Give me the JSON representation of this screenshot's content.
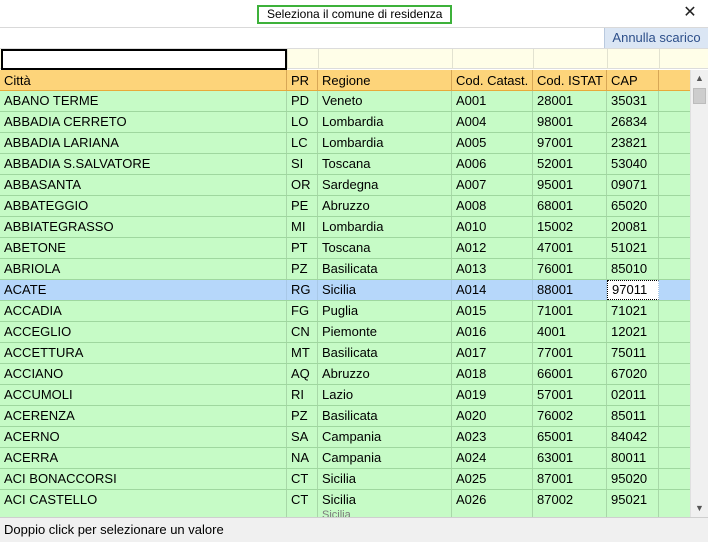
{
  "window": {
    "title": "Seleziona il comune di residenza",
    "close_glyph": "✕",
    "close_icon": "close-icon"
  },
  "toolbar": {
    "annulla_label": "Annulla scarico"
  },
  "filter": {
    "value": "",
    "placeholder": ""
  },
  "columns": [
    "Città",
    "PR",
    "Regione",
    "Cod. Catast.",
    "Cod. ISTAT",
    "CAP"
  ],
  "rows": [
    [
      "ABANO TERME",
      "PD",
      "Veneto",
      "A001",
      "28001",
      "35031"
    ],
    [
      "ABBADIA CERRETO",
      "LO",
      "Lombardia",
      "A004",
      "98001",
      "26834"
    ],
    [
      "ABBADIA LARIANA",
      "LC",
      "Lombardia",
      "A005",
      "97001",
      "23821"
    ],
    [
      "ABBADIA S.SALVATORE",
      "SI",
      "Toscana",
      "A006",
      "52001",
      "53040"
    ],
    [
      "ABBASANTA",
      "OR",
      "Sardegna",
      "A007",
      "95001",
      "09071"
    ],
    [
      "ABBATEGGIO",
      "PE",
      "Abruzzo",
      "A008",
      "68001",
      "65020"
    ],
    [
      "ABBIATEGRASSO",
      "MI",
      "Lombardia",
      "A010",
      "15002",
      "20081"
    ],
    [
      "ABETONE",
      "PT",
      "Toscana",
      "A012",
      "47001",
      "51021"
    ],
    [
      "ABRIOLA",
      "PZ",
      "Basilicata",
      "A013",
      "76001",
      "85010"
    ],
    [
      "ACATE",
      "RG",
      "Sicilia",
      "A014",
      "88001",
      "97011"
    ],
    [
      "ACCADIA",
      "FG",
      "Puglia",
      "A015",
      "71001",
      "71021"
    ],
    [
      "ACCEGLIO",
      "CN",
      "Piemonte",
      "A016",
      "4001",
      "12021"
    ],
    [
      "ACCETTURA",
      "MT",
      "Basilicata",
      "A017",
      "77001",
      "75011"
    ],
    [
      "ACCIANO",
      "AQ",
      "Abruzzo",
      "A018",
      "66001",
      "67020"
    ],
    [
      "ACCUMOLI",
      "RI",
      "Lazio",
      "A019",
      "57001",
      "02011"
    ],
    [
      "ACERENZA",
      "PZ",
      "Basilicata",
      "A020",
      "76002",
      "85011"
    ],
    [
      "ACERNO",
      "SA",
      "Campania",
      "A023",
      "65001",
      "84042"
    ],
    [
      "ACERRA",
      "NA",
      "Campania",
      "A024",
      "63001",
      "80011"
    ],
    [
      "ACI BONACCORSI",
      "CT",
      "Sicilia",
      "A025",
      "87001",
      "95020"
    ],
    [
      "ACI CASTELLO",
      "CT",
      "Sicilia",
      "A026",
      "87002",
      "95021"
    ]
  ],
  "partial_row": [
    "",
    "",
    "Sicilia",
    "",
    "",
    ""
  ],
  "selected_row_index": 9,
  "focused_column_index": 5,
  "status": {
    "text": "Doppio click per selezionare un valore"
  },
  "scrollbar": {
    "up_glyph": "▲",
    "down_glyph": "▼"
  },
  "colors": {
    "header": "#fdd47a",
    "row": "#c6fbc6",
    "selected": "#b6d7fa",
    "title_border": "#3db13a"
  }
}
